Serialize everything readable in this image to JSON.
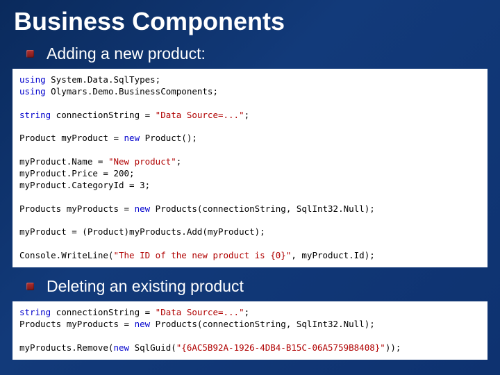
{
  "slide": {
    "title": "Business Components",
    "bullet1": "Adding a new product:",
    "bullet2": "Deleting an existing product"
  },
  "code1": {
    "l01a": "using",
    "l01b": " System.Data.SqlTypes;",
    "l02a": "using",
    "l02b": " Olymars.Demo.BusinessComponents;",
    "blank1": "",
    "l03a": "string",
    "l03b": " connectionString = ",
    "l03c": "\"Data Source=...\"",
    "l03d": ";",
    "blank2": "",
    "l04a": "Product myProduct = ",
    "l04b": "new",
    "l04c": " Product();",
    "blank3": "",
    "l05a": "myProduct.Name = ",
    "l05b": "\"New product\"",
    "l05c": ";",
    "l06": "myProduct.Price = 200;",
    "l07": "myProduct.CategoryId = 3;",
    "blank4": "",
    "l08a": "Products myProducts = ",
    "l08b": "new",
    "l08c": " Products(connectionString, SqlInt32.Null);",
    "blank5": "",
    "l09": "myProduct = (Product)myProducts.Add(myProduct);",
    "blank6": "",
    "l10a": "Console.WriteLine(",
    "l10b": "\"The ID of the new product is {0}\"",
    "l10c": ", myProduct.Id);"
  },
  "code2": {
    "l01a": "string",
    "l01b": " connectionString = ",
    "l01c": "\"Data Source=...\"",
    "l01d": ";",
    "l02a": "Products myProducts = ",
    "l02b": "new",
    "l02c": " Products(connectionString, SqlInt32.Null);",
    "blank1": "",
    "l03a": "myProducts.Remove(",
    "l03b": "new",
    "l03c": " SqlGuid(",
    "l03d": "\"{6AC5B92A-1926-4DB4-B15C-06A5759B8408}\"",
    "l03e": "));"
  }
}
